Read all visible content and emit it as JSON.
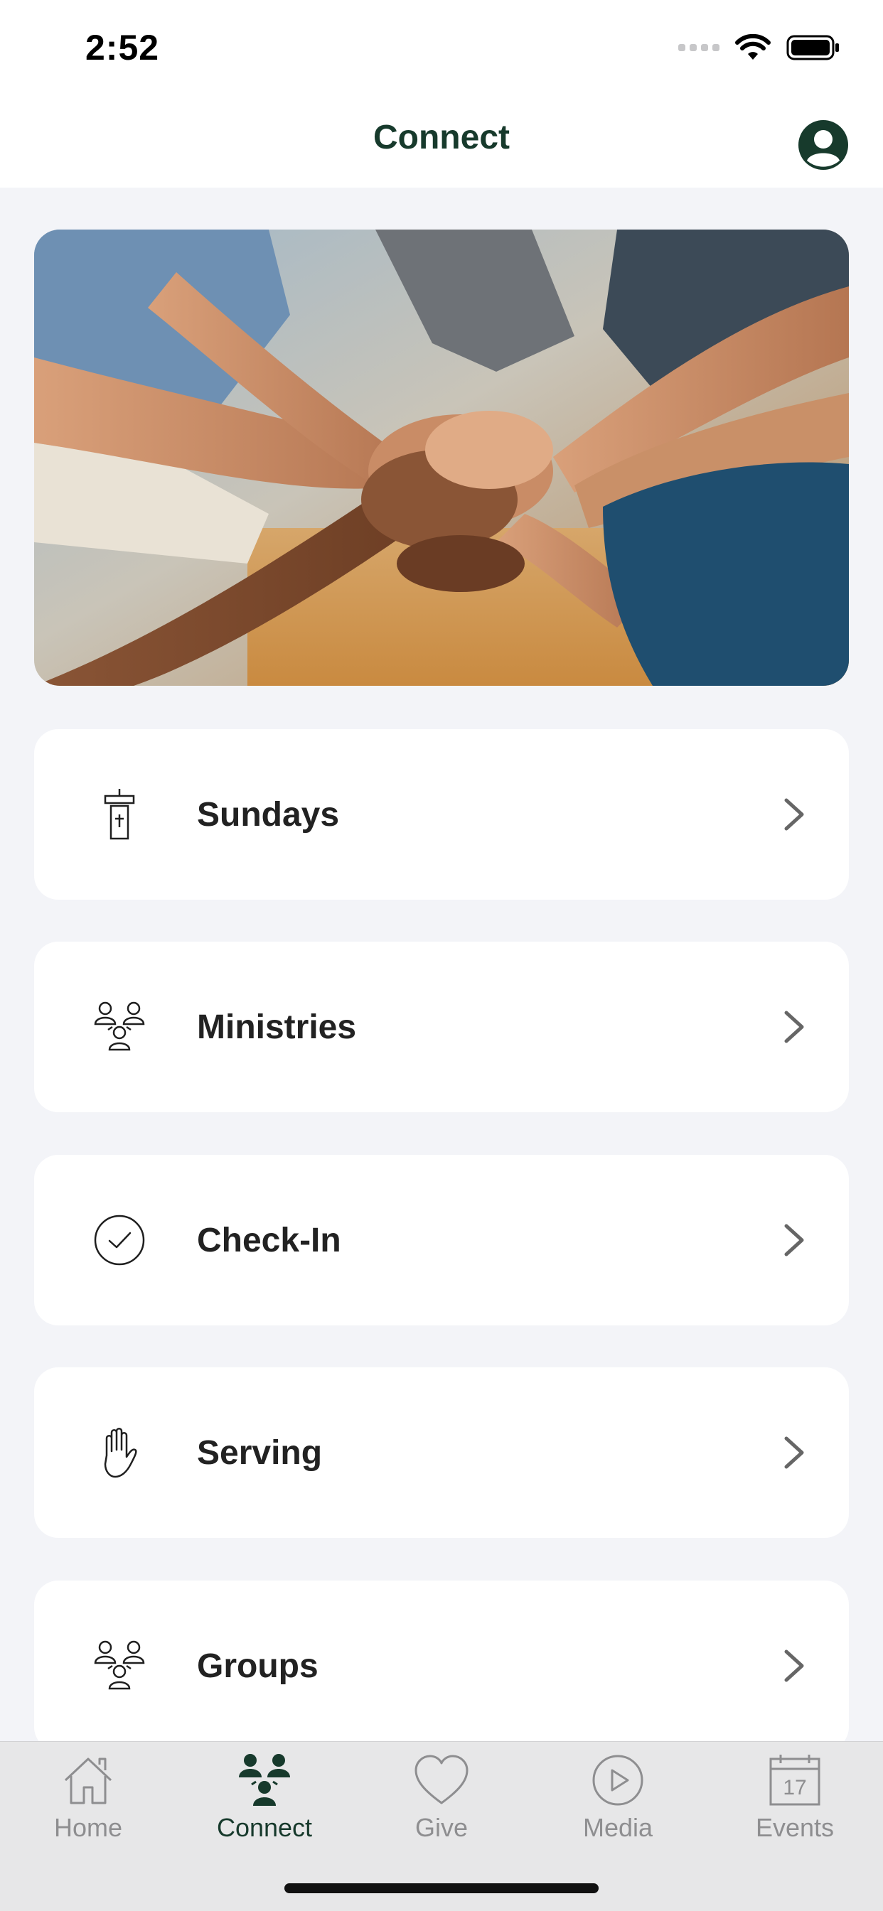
{
  "status_bar": {
    "time": "2:52"
  },
  "header": {
    "title": "Connect",
    "profile_icon": "person-circle-icon"
  },
  "hero": {
    "icon": "hands-together-photo"
  },
  "menu": [
    {
      "label": "Sundays",
      "icon": "podium-icon"
    },
    {
      "label": "Ministries",
      "icon": "people-group-icon"
    },
    {
      "label": "Check-In",
      "icon": "check-circle-icon"
    },
    {
      "label": "Serving",
      "icon": "hand-icon"
    },
    {
      "label": "Groups",
      "icon": "people-group-icon"
    }
  ],
  "tabs": [
    {
      "label": "Home",
      "icon": "house-icon"
    },
    {
      "label": "Connect",
      "icon": "people-group-icon",
      "active": true
    },
    {
      "label": "Give",
      "icon": "heart-icon"
    },
    {
      "label": "Media",
      "icon": "play-circle-icon"
    },
    {
      "label": "Events",
      "icon": "calendar-icon",
      "calendar_day": "17"
    }
  ],
  "colors": {
    "brand": "#173a2c",
    "background": "#f3f4f8",
    "tab_inactive": "#8e8e90"
  }
}
